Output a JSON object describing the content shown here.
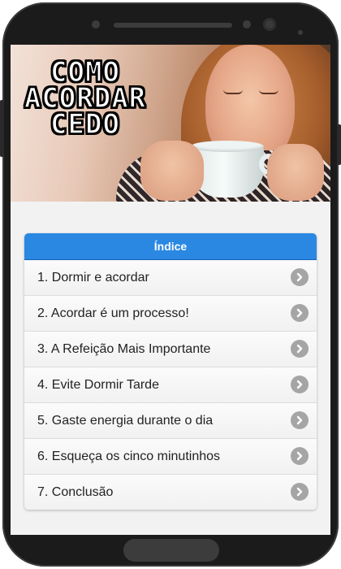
{
  "hero": {
    "title_lines": [
      "COMO",
      "ACORDAR",
      "CEDO"
    ]
  },
  "index": {
    "header": "Índice",
    "items": [
      {
        "label": "1. Dormir e acordar"
      },
      {
        "label": "2. Acordar é um processo!"
      },
      {
        "label": "3. A Refeição Mais Importante"
      },
      {
        "label": "4. Evite Dormir Tarde"
      },
      {
        "label": "5. Gaste energia durante o dia"
      },
      {
        "label": "6. Esqueça os cinco minutinhos"
      },
      {
        "label": "7. Conclusão"
      }
    ],
    "item_icon": "chevron-right-icon"
  },
  "colors": {
    "header_blue": "#2a88e3",
    "chevron_gray": "#a5a5a5",
    "phone_body": "#1b1b1b",
    "screen_bg": "#f2f2f2"
  }
}
